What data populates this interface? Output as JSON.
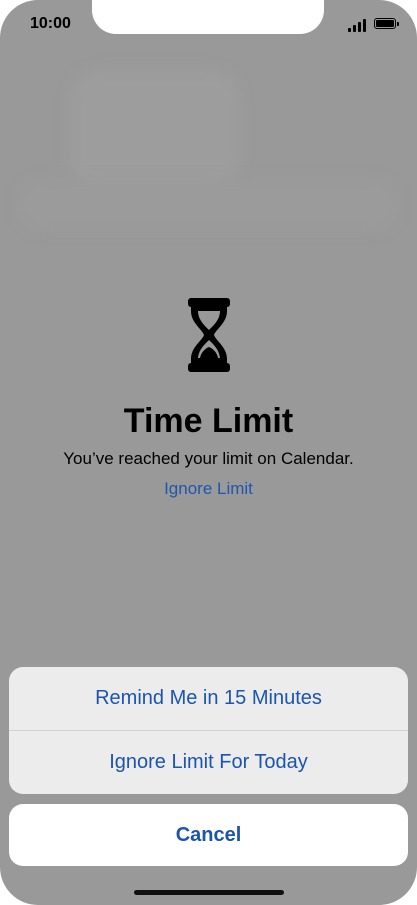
{
  "status_bar": {
    "time": "10:00",
    "signal_icon": "signal-bars-icon",
    "battery_icon": "battery-icon"
  },
  "alert": {
    "icon": "hourglass-icon",
    "title": "Time Limit",
    "message": "You’ve reached your limit on Calendar.",
    "ignore_link": "Ignore Limit"
  },
  "action_sheet": {
    "options": [
      {
        "label": "Remind Me in 15 Minutes"
      },
      {
        "label": "Ignore Limit For Today"
      }
    ],
    "cancel_label": "Cancel"
  },
  "colors": {
    "overlay": "#999999",
    "accent": "#1b55ae",
    "sheet_bg": "#ececec"
  }
}
